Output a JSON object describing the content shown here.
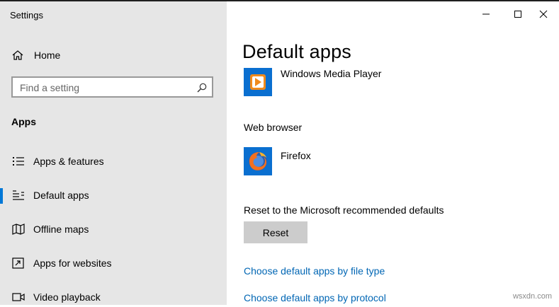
{
  "window": {
    "title": "Settings"
  },
  "sidebar": {
    "home_label": "Home",
    "search": {
      "placeholder": "Find a setting"
    },
    "section_title": "Apps",
    "items": [
      {
        "label": "Apps & features",
        "icon": "list-icon"
      },
      {
        "label": "Default apps",
        "icon": "default-apps-icon",
        "active": true
      },
      {
        "label": "Offline maps",
        "icon": "map-icon"
      },
      {
        "label": "Apps for websites",
        "icon": "open-in-app-icon"
      },
      {
        "label": "Video playback",
        "icon": "video-icon"
      }
    ]
  },
  "main": {
    "title": "Default apps",
    "video_player": {
      "app_name": "Windows Media Player"
    },
    "web_browser": {
      "label": "Web browser",
      "app_name": "Firefox"
    },
    "reset": {
      "label": "Reset to the Microsoft recommended defaults",
      "button_label": "Reset"
    },
    "links": [
      "Choose default apps by file type",
      "Choose default apps by protocol"
    ]
  },
  "watermark": "wsxdn.com",
  "colors": {
    "accent": "#0078d7",
    "link": "#0066b4",
    "sidebar_bg": "#e6e6e6",
    "button_bg": "#cccccc"
  }
}
